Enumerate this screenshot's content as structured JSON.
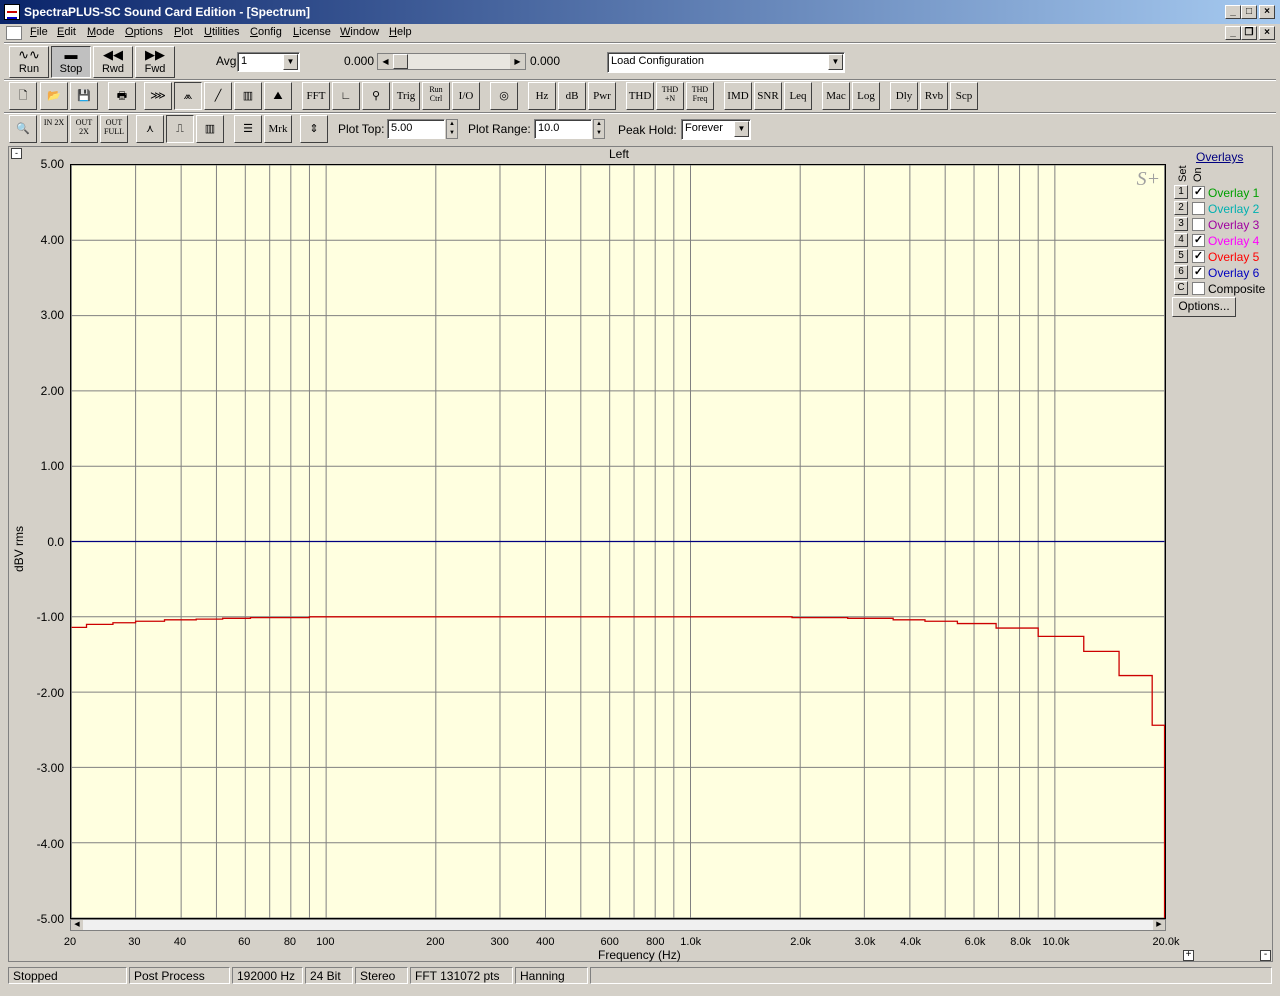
{
  "window": {
    "title": "SpectraPLUS-SC Sound Card Edition - [Spectrum]"
  },
  "menu": [
    "File",
    "Edit",
    "Mode",
    "Options",
    "Plot",
    "Utilities",
    "Config",
    "License",
    "Window",
    "Help"
  ],
  "toolbar1": {
    "run": "Run",
    "stop": "Stop",
    "rwd": "Rwd",
    "fwd": "Fwd",
    "avg_label": "Avg",
    "avg_value": "1",
    "pos_left": "0.000",
    "pos_right": "0.000",
    "config_value": "Load Configuration"
  },
  "toolbar2": {
    "fft": "FFT",
    "trig": "Trig",
    "run_ctrl": "Run Ctrl",
    "io": "I/O",
    "hz": "Hz",
    "db": "dB",
    "pwr": "Pwr",
    "thd": "THD",
    "thdn": "THD +N",
    "thdfreq": "THD Freq",
    "imd": "IMD",
    "snr": "SNR",
    "leq": "Leq",
    "mac": "Mac",
    "log": "Log",
    "dly": "Dly",
    "rvb": "Rvb",
    "scp": "Scp"
  },
  "toolbar3": {
    "zin": "IN 2X",
    "zout": "OUT 2X",
    "zfull": "OUT FULL",
    "mrk": "Mrk",
    "plot_top_label": "Plot Top:",
    "plot_top_value": "5.00",
    "plot_range_label": "Plot Range:",
    "plot_range_value": "10.0",
    "peak_hold_label": "Peak Hold:",
    "peak_hold_value": "Forever"
  },
  "overlays": {
    "header": "Overlays",
    "col_set": "Set",
    "col_on": "On",
    "items": [
      {
        "num": "1",
        "label": "Overlay 1",
        "checked": true,
        "color": "#00a000"
      },
      {
        "num": "2",
        "label": "Overlay 2",
        "checked": false,
        "color": "#00b0b0"
      },
      {
        "num": "3",
        "label": "Overlay 3",
        "checked": false,
        "color": "#a000a0"
      },
      {
        "num": "4",
        "label": "Overlay 4",
        "checked": true,
        "color": "#ff00ff"
      },
      {
        "num": "5",
        "label": "Overlay 5",
        "checked": true,
        "color": "#ff0000"
      },
      {
        "num": "6",
        "label": "Overlay 6",
        "checked": true,
        "color": "#0000c0"
      },
      {
        "num": "C",
        "label": "Composite",
        "checked": false,
        "color": "#000000"
      }
    ],
    "options_button": "Options..."
  },
  "chart_data": {
    "type": "line",
    "title": "Left",
    "xlabel": "Frequency (Hz)",
    "ylabel": "dBV rms",
    "x_scale": "log",
    "xlim": [
      20,
      20000
    ],
    "ylim": [
      -5,
      5
    ],
    "grid": true,
    "x_tick_labels": [
      "20",
      "30",
      "40",
      "60",
      "80",
      "100",
      "200",
      "300",
      "400",
      "600",
      "800",
      "1.0k",
      "2.0k",
      "3.0k",
      "4.0k",
      "6.0k",
      "8.0k",
      "10.0k",
      "20.0k"
    ],
    "x_tick_values": [
      20,
      30,
      40,
      60,
      80,
      100,
      200,
      300,
      400,
      600,
      800,
      1000,
      2000,
      3000,
      4000,
      6000,
      8000,
      10000,
      20000
    ],
    "y_tick_labels": [
      "5.00",
      "4.00",
      "3.00",
      "2.00",
      "1.00",
      "0.0",
      "-1.00",
      "-2.00",
      "-3.00",
      "-4.00",
      "-5.00"
    ],
    "y_tick_values": [
      5,
      4,
      3,
      2,
      1,
      0,
      -1,
      -2,
      -3,
      -4,
      -5
    ],
    "series": [
      {
        "color": "#000080",
        "points": [
          [
            20,
            0.0
          ],
          [
            20000,
            0.0
          ]
        ]
      },
      {
        "color": "#cc0000",
        "points": [
          [
            20,
            -1.14
          ],
          [
            22,
            -1.14
          ],
          [
            22,
            -1.1
          ],
          [
            26,
            -1.1
          ],
          [
            26,
            -1.08
          ],
          [
            30,
            -1.08
          ],
          [
            30,
            -1.06
          ],
          [
            36,
            -1.06
          ],
          [
            36,
            -1.04
          ],
          [
            44,
            -1.04
          ],
          [
            44,
            -1.03
          ],
          [
            52,
            -1.03
          ],
          [
            52,
            -1.02
          ],
          [
            62,
            -1.02
          ],
          [
            62,
            -1.01
          ],
          [
            90,
            -1.01
          ],
          [
            90,
            -1.0
          ],
          [
            1900,
            -1.0
          ],
          [
            1900,
            -1.01
          ],
          [
            2700,
            -1.01
          ],
          [
            2700,
            -1.02
          ],
          [
            3600,
            -1.02
          ],
          [
            3600,
            -1.04
          ],
          [
            4400,
            -1.04
          ],
          [
            4400,
            -1.06
          ],
          [
            5400,
            -1.06
          ],
          [
            5400,
            -1.09
          ],
          [
            6900,
            -1.09
          ],
          [
            6900,
            -1.15
          ],
          [
            9000,
            -1.15
          ],
          [
            9000,
            -1.26
          ],
          [
            12000,
            -1.26
          ],
          [
            12000,
            -1.46
          ],
          [
            15000,
            -1.46
          ],
          [
            15000,
            -1.78
          ],
          [
            18500,
            -1.78
          ],
          [
            18500,
            -2.44
          ],
          [
            20000,
            -2.44
          ],
          [
            20000,
            -5.0
          ]
        ]
      }
    ],
    "logo": "S+"
  },
  "status": {
    "state": "Stopped",
    "mode": "Post Process",
    "rate": "192000 Hz",
    "bits": "24 Bit",
    "channels": "Stereo",
    "fft": "FFT 131072 pts",
    "window": "Hanning"
  }
}
